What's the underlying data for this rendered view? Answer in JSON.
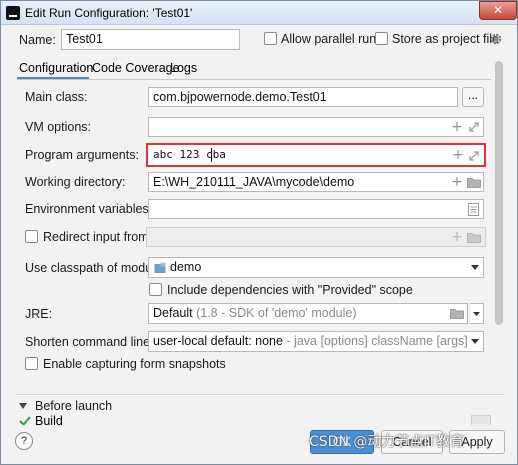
{
  "window": {
    "title": "Edit Run Configuration: 'Test01'",
    "close_label": "✕"
  },
  "header": {
    "name_label": "Name:",
    "name_value": "Test01",
    "allow_parallel_label": "Allow parallel run",
    "store_project_label": "Store as project file"
  },
  "tabs": [
    {
      "label": "Configuration"
    },
    {
      "label": "Code Coverage"
    },
    {
      "label": "Logs"
    }
  ],
  "form": {
    "main_class_label": "Main class:",
    "main_class_value": "com.bjpowernode.demo.Test01",
    "main_class_browse": "...",
    "vm_options_label": "VM options:",
    "vm_options_value": "",
    "program_args_label": "Program arguments:",
    "program_args_value": "abc 123 cba",
    "working_dir_label": "Working directory:",
    "working_dir_value": "E:\\WH_210111_JAVA\\mycode\\demo",
    "env_vars_label": "Environment variables:",
    "env_vars_value": "",
    "redirect_input_label": "Redirect input from:",
    "classpath_label": "Use classpath of module:",
    "classpath_value": "demo",
    "include_deps_label": "Include dependencies with \"Provided\" scope",
    "jre_label": "JRE:",
    "jre_value_main": "Default",
    "jre_value_detail": "(1.8 - SDK of 'demo' module)",
    "shorten_label": "Shorten command line:",
    "shorten_value_main": "user-local default: none",
    "shorten_value_detail": "- java [options] className [args]",
    "capture_snapshots_label": "Enable capturing form snapshots"
  },
  "before_launch": {
    "label": "Before launch",
    "item_partial": "Build"
  },
  "footer": {
    "help": "?",
    "ok": "OK",
    "cancel": "Cancel",
    "apply": "Apply",
    "watermark": "CSDN @动力节点IT教育"
  },
  "colors": {
    "highlight_border": "#e0313c",
    "ok_button": "#4a8fd6",
    "tab_underline": "#4a88c7"
  }
}
